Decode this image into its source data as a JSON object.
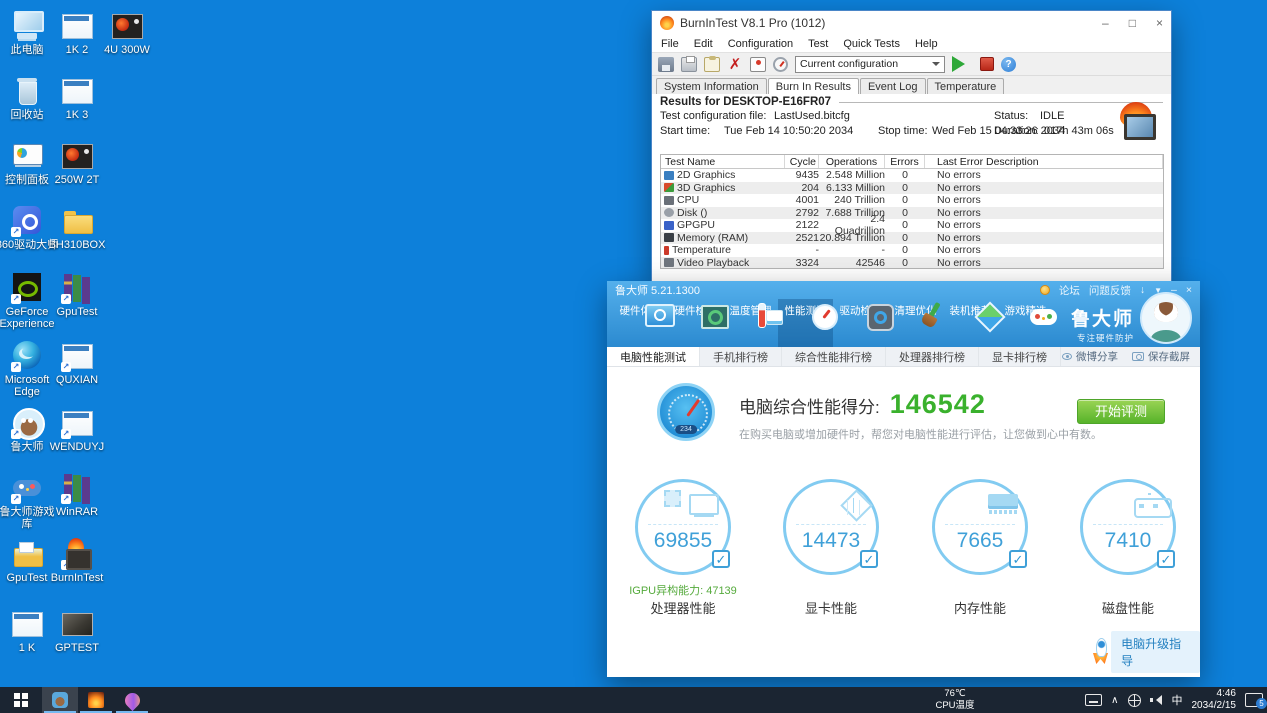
{
  "colors": {
    "desktop_blue": "#0d80da",
    "masterlu_header_blue": "#3b9ce4",
    "score_green": "#3ab12d",
    "card_accent_blue": "#3fa0d8",
    "button_green": "#57b32a",
    "taskbar_dark": "#1b2532"
  },
  "icons": {
    "check": "✓",
    "shortcut": "↗",
    "min": "–",
    "max": "□",
    "close": "×",
    "down": "↓",
    "skin": "▼",
    "help": "?",
    "delete": "✗",
    "chevron_up": "∧"
  },
  "desktop": {
    "col1": [
      {
        "label": "此电脑"
      },
      {
        "label": "回收站"
      },
      {
        "label": "控制面板"
      },
      {
        "label": "360驱动大师"
      },
      {
        "label": "GeForce Experience"
      },
      {
        "label": "Microsoft Edge"
      },
      {
        "label": "鲁大师"
      },
      {
        "label": "鲁大师游戏库"
      },
      {
        "label": "GpuTest"
      },
      {
        "label": "1 K"
      }
    ],
    "col2": [
      {
        "label": "1K 2"
      },
      {
        "label": "1K 3"
      },
      {
        "label": "250W 2T"
      },
      {
        "label": "BH310BOX"
      },
      {
        "label": "GpuTest"
      },
      {
        "label": "QUXIAN"
      },
      {
        "label": "WENDUYJ"
      },
      {
        "label": "WinRAR"
      },
      {
        "label": "BurnInTest"
      },
      {
        "label": "GPTEST"
      }
    ],
    "col3": [
      {
        "label": "4U 300W"
      }
    ]
  },
  "burnintest": {
    "title": "BurnInTest V8.1 Pro (1012)",
    "menu": {
      "file": "File",
      "edit": "Edit",
      "configuration": "Configuration",
      "test": "Test",
      "quick_tests": "Quick Tests",
      "help": "Help"
    },
    "toolbar": {
      "config_select": "Current configuration"
    },
    "tabs": {
      "t0": "System Information",
      "t1": "Burn In Results",
      "t2": "Event Log",
      "t3": "Temperature"
    },
    "results_title": "Results for DESKTOP-E16FR07",
    "info": {
      "config_label": "Test configuration file:",
      "config_value": "LastUsed.bitcfg",
      "start_label": "Start time:",
      "start_value": "Tue Feb 14 10:50:20 2034",
      "stop_label": "Stop time:",
      "stop_value": "Wed Feb 15 04:33:26 2034",
      "status_label": "Status:",
      "status_value": "IDLE",
      "duration_label": "Duration:",
      "duration_value": "017h 43m 06s"
    },
    "table": {
      "headers": {
        "name": "Test Name",
        "cycle": "Cycle",
        "operations": "Operations",
        "errors": "Errors",
        "desc": "Last Error Description"
      },
      "rows": [
        {
          "name": "2D Graphics",
          "cycle": "9435",
          "operations": "2.548 Million",
          "errors": "0",
          "desc": "No errors"
        },
        {
          "name": "3D Graphics",
          "cycle": "204",
          "operations": "6.133 Million",
          "errors": "0",
          "desc": "No errors"
        },
        {
          "name": "CPU",
          "cycle": "4001",
          "operations": "240 Trillion",
          "errors": "0",
          "desc": "No errors"
        },
        {
          "name": "Disk ()",
          "cycle": "2792",
          "operations": "7.688 Trillion",
          "errors": "0",
          "desc": "No errors"
        },
        {
          "name": "GPGPU",
          "cycle": "2122",
          "operations": "2.4 Quadrillion",
          "errors": "0",
          "desc": "No errors"
        },
        {
          "name": "Memory (RAM)",
          "cycle": "2521",
          "operations": "20.894 Trillion",
          "errors": "0",
          "desc": "No errors"
        },
        {
          "name": "Temperature",
          "cycle": "-",
          "operations": "-",
          "errors": "0",
          "desc": "No errors"
        },
        {
          "name": "Video Playback",
          "cycle": "3324",
          "operations": "42546",
          "errors": "0",
          "desc": "No errors"
        }
      ]
    }
  },
  "masterlu": {
    "title": "鲁大师 5.21.1300",
    "titlebar": {
      "forum": "论坛",
      "feedback": "问题反馈"
    },
    "nav": [
      {
        "label": "硬件体检"
      },
      {
        "label": "硬件检测"
      },
      {
        "label": "温度管理"
      },
      {
        "label": "性能测试"
      },
      {
        "label": "驱动检测"
      },
      {
        "label": "清理优化"
      },
      {
        "label": "装机推荐"
      },
      {
        "label": "游戏精选"
      }
    ],
    "brand": {
      "name": "鲁大师",
      "slogan": "专注硬件防护"
    },
    "tabs": [
      {
        "label": "电脑性能测试"
      },
      {
        "label": "手机排行榜"
      },
      {
        "label": "综合性能排行榜"
      },
      {
        "label": "处理器排行榜"
      },
      {
        "label": "显卡排行榜"
      }
    ],
    "tab_actions": {
      "weibo_share": "微博分享",
      "save_screenshot": "保存截屏"
    },
    "score": {
      "label": "电脑综合性能得分:",
      "value": "146542",
      "desc": "在购买电脑或增加硬件时，帮您对电脑性能进行评估，让您做到心中有数。",
      "gauge_text": "234",
      "start_button": "开始评测"
    },
    "cards": [
      {
        "value": "69855",
        "extra": "IGPU异构能力: 47139",
        "label": "处理器性能"
      },
      {
        "value": "14473",
        "extra": "",
        "label": "显卡性能"
      },
      {
        "value": "7665",
        "extra": "",
        "label": "内存性能"
      },
      {
        "value": "7410",
        "extra": "",
        "label": "磁盘性能"
      }
    ],
    "upgrade_guide": "电脑升级指导"
  },
  "taskbar": {
    "cpu_temp": "76℃",
    "cpu_temp_label": "CPU温度",
    "ime": "中",
    "time": "4:46",
    "date": "2034/2/15",
    "notification_count": "5"
  }
}
